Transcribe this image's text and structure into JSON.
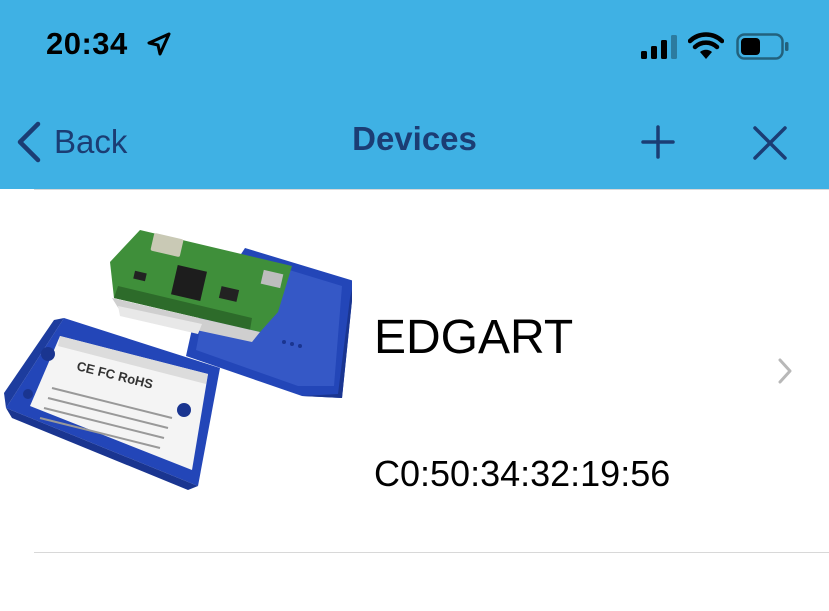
{
  "status_bar": {
    "time": "20:34",
    "icons": [
      "location-arrow-icon",
      "cellular-signal-icon",
      "wifi-icon",
      "battery-icon"
    ]
  },
  "nav_bar": {
    "back_label": "Back",
    "title": "Devices",
    "icons": [
      "chevron-left-icon",
      "plus-icon",
      "close-icon"
    ]
  },
  "devices": [
    {
      "name": "EDGART",
      "mac": "C0:50:34:32:19:56",
      "image": "sensor-device-image"
    }
  ],
  "colors": {
    "header_bg": "#3fb1e4",
    "nav_text": "#1b3d74",
    "device_blue": "#2346b8",
    "pcb_green": "#3f8f3a"
  }
}
